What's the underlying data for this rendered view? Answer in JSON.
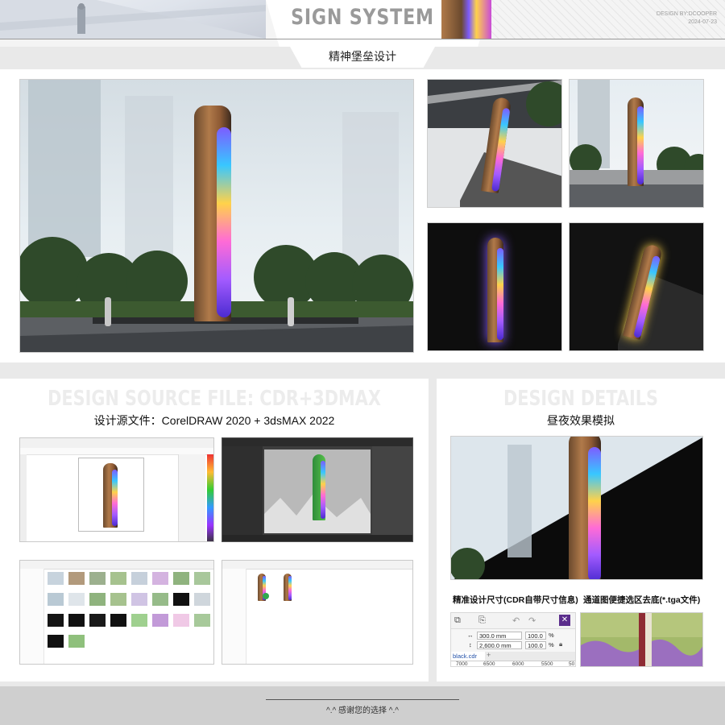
{
  "header": {
    "brand": "SIGN SYSTEM",
    "subtitle": "精神堡垒设计",
    "credit_line1": "DESIGN BY:DCOOPER",
    "credit_line2": "2024-07-23"
  },
  "source_section": {
    "ghost_title": "DESIGN SOURCE FILE: CDR+3DMAX",
    "caption": "设计源文件：CorelDRAW 2020  +  3dsMAX 2022"
  },
  "details_section": {
    "ghost_title": "DESIGN DETAILS",
    "caption": "昼夜效果模拟",
    "size_caption": "精准设计尺寸(CDR自带尺寸信息)",
    "channel_caption": "通道图便捷选区去底(*.tga文件)"
  },
  "cdr_widget": {
    "width_value": "300.0 mm",
    "height_value": "2,600.0 mm",
    "pct1": "100.0",
    "pct2": "100.0",
    "pct_sign": "%",
    "file_tab": "black.cdr",
    "ruler": [
      "7000",
      "6500",
      "6000",
      "5500",
      "50"
    ]
  },
  "footer": {
    "thanks": "^.^  感谢您的选择  ^.^"
  },
  "colors": {
    "accent_purple": "#8a5cff",
    "totem_bronze": "#a8703f"
  }
}
